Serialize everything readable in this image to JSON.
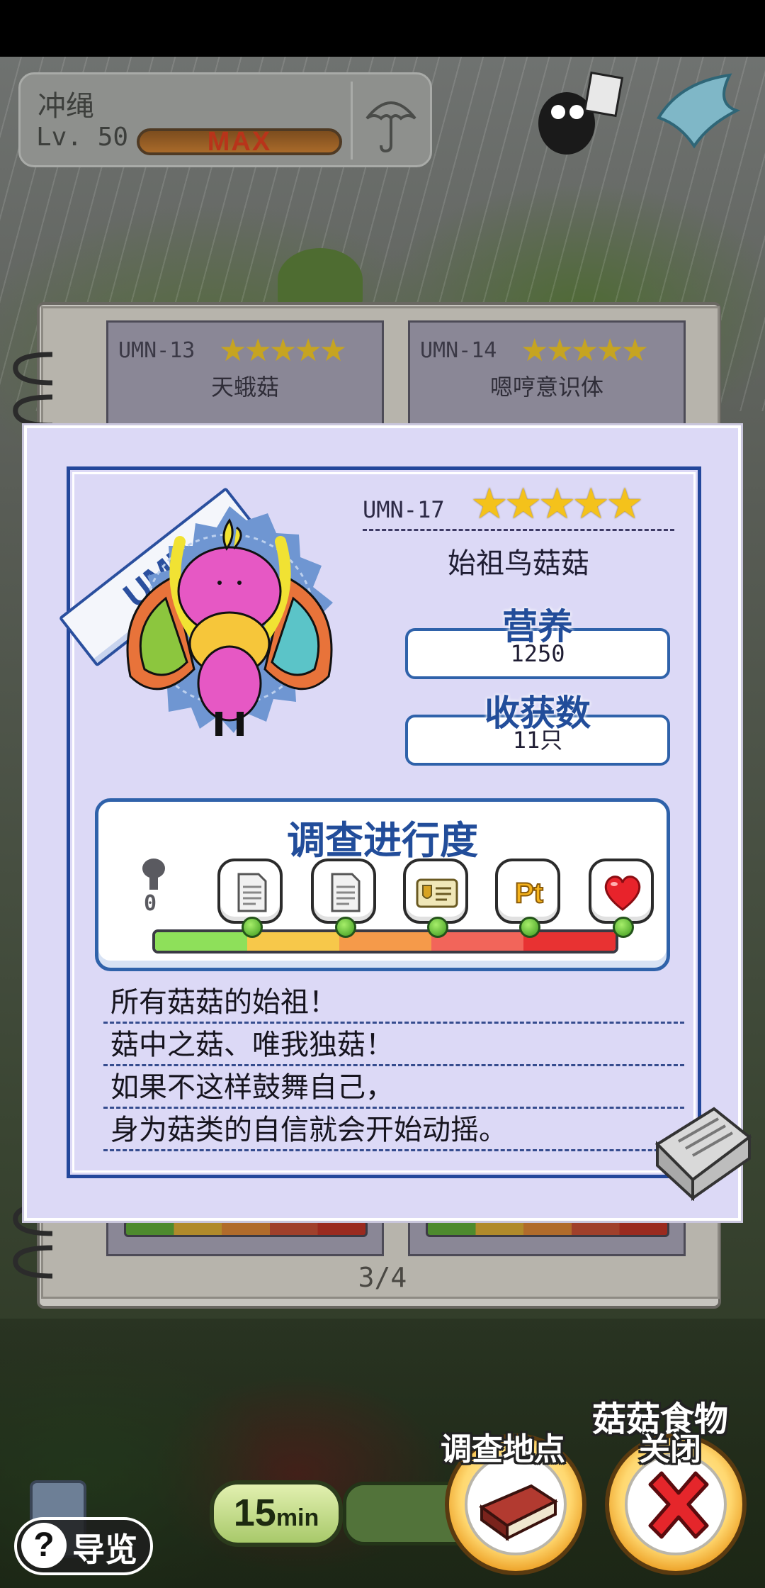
{
  "location": {
    "name": "冲绳",
    "level": "Lv. 50",
    "level_status": "MAX"
  },
  "notebook": {
    "page_indicator": "3/4",
    "background_cards": [
      {
        "id": "UMN-13",
        "stars": "★★★★★",
        "name": "天蛾菇"
      },
      {
        "id": "UMN-14",
        "stars": "★★★★★",
        "name": "嗯哼意识体"
      }
    ]
  },
  "detail": {
    "category_ribbon": "UMN",
    "id": "UMN-17",
    "stars": "★★★★★",
    "rating": 5,
    "name": "始祖鸟菇菇",
    "nutrition_label": "营养",
    "nutrition_value": "1250",
    "harvest_label": "收获数",
    "harvest_value": "11只",
    "progress_title": "调查进行度",
    "progress_count": "0",
    "milestones": [
      {
        "icon": "document-icon"
      },
      {
        "icon": "document-icon"
      },
      {
        "icon": "id-card-icon"
      },
      {
        "icon": "pt-points-icon"
      },
      {
        "icon": "heart-icon"
      }
    ],
    "description": [
      "所有菇菇的始祖！",
      "菇中之菇、唯我独菇！",
      "如果不这样鼓舞自己，",
      "身为菇类的自信就会开始动摇。"
    ]
  },
  "hud": {
    "timer_value": "15",
    "timer_unit": "min",
    "mushroom_food_label": "菇菇食物",
    "survey_location_label": "调查地点",
    "close_label": "关闭",
    "guide_symbol": "?",
    "guide_label": "导览"
  },
  "colors": {
    "frame_blue": "#23479b",
    "card_bg": "#dcd9f6",
    "star_gold": "#f4c21b",
    "close_red": "#e5262b"
  }
}
